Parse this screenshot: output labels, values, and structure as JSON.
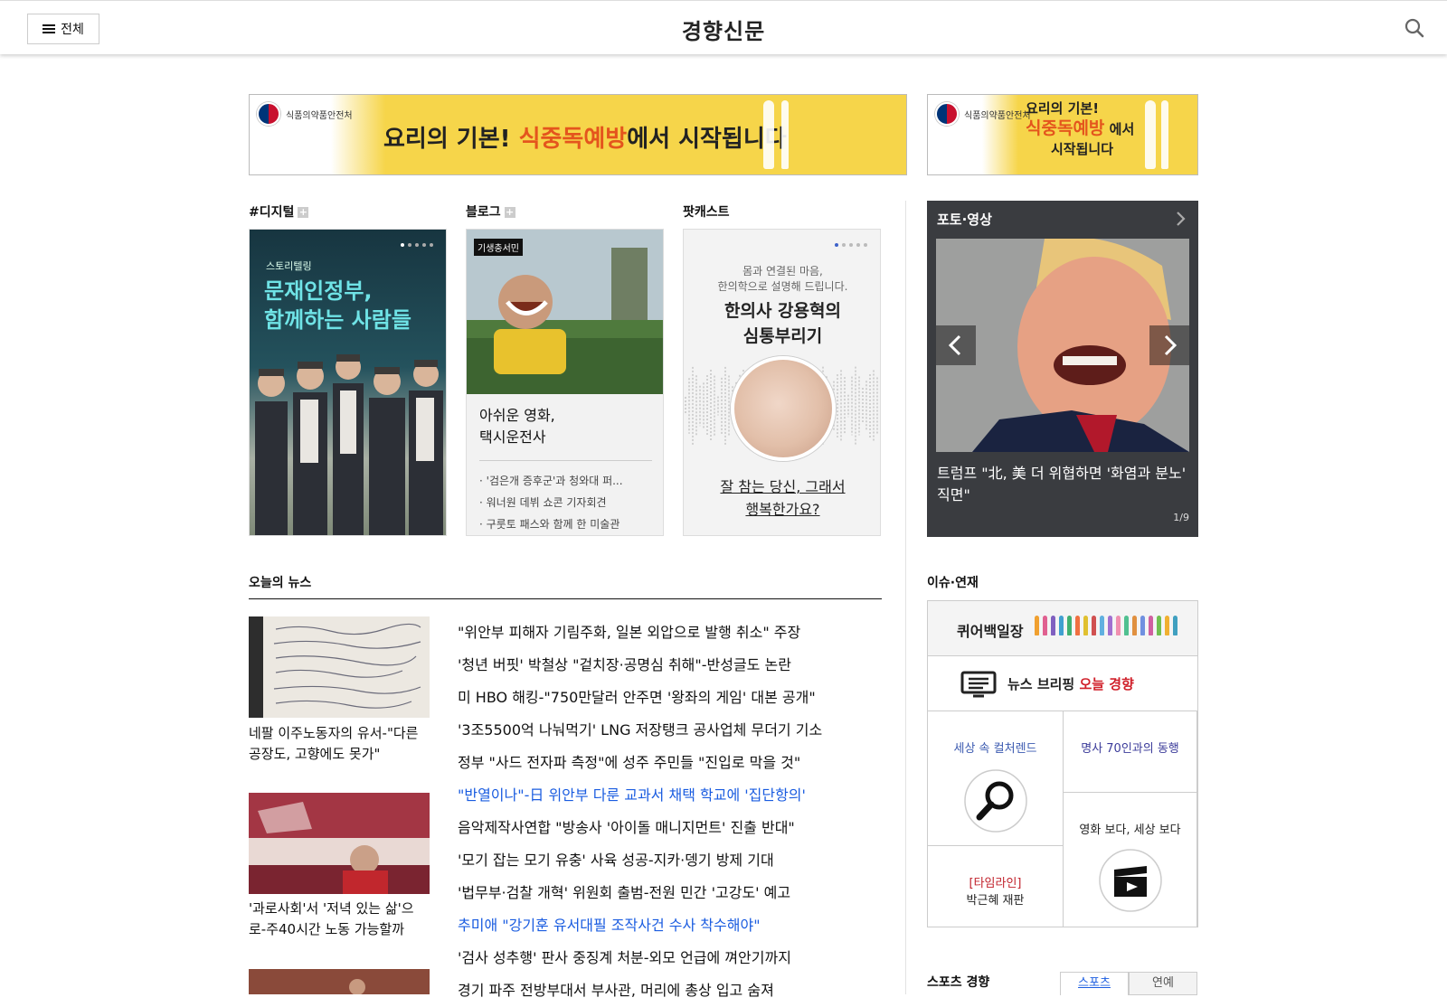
{
  "header": {
    "menu_label": "전체",
    "logo": "경향신문"
  },
  "ads": {
    "agency": "식품의약품안전처",
    "left_copy_1": "요리의 기본!",
    "left_copy_hi": "식중독예방",
    "left_copy_2": "에서 시작됩니다",
    "right_copy_1": "요리의 기본!",
    "right_copy_hi": "식중독예방",
    "right_copy_2": "에서",
    "right_copy_3": "시작됩니다"
  },
  "sections": {
    "digital": {
      "title": "#디지털",
      "kicker": "스토리텔링",
      "headline_1": "문재인정부,",
      "headline_2": "함께하는 사람들"
    },
    "blog": {
      "title": "블로그",
      "tag": "기생충서민",
      "title_1": "아쉬운 영화,",
      "title_2": "택시운전사",
      "items": [
        "'검은개 증후군'과 청와대 퍼...",
        "워너원 데뷔 쇼콘 기자회견",
        "구룻토 패스와 함께 한 미술관"
      ]
    },
    "podcast": {
      "title": "팟캐스트",
      "sub_1": "몸과 연결된 마음,",
      "sub_2": "한의학으로 설명해 드립니다.",
      "title_1": "한의사 강용혁의",
      "title_2": "심통부리기",
      "bottom_1": "잘 참는 당신, 그래서",
      "bottom_2": "행복한가요?"
    },
    "photo": {
      "title": "포토·영상",
      "caption": "트럼프 \"北, 美 더 위협하면 '화염과 분노' 직면\"",
      "counter": "1/9"
    }
  },
  "news": {
    "title": "오늘의 뉴스",
    "thumbs": [
      {
        "caption": "네팔 이주노동자의 유서-\"다른 공장도, 고향에도 못가\""
      },
      {
        "caption": "'과로사회'서 '저녁 있는 삶'으로-주40시간 노동 가능할까"
      }
    ],
    "headlines": [
      "\"위안부 피해자 기림주화, 일본 외압으로 발행 취소\" 주장",
      "'청년 버핏' 박철상 \"겉치장·공명심 취해\"-반성글도 논란",
      "미 HBO 해킹-\"750만달러 안주면 '왕좌의 게임' 대본 공개\"",
      "'3조5500억 나눠먹기' LNG 저장탱크 공사업체 무더기 기소",
      "정부 \"사드 전자파 측정\"에 성주 주민들 \"진입로 막을 것\"",
      "\"반열이나\"-日 위안부 다룬 교과서 채택 학교에 '집단항의'",
      "음악제작사연합 \"방송사 '아이돌 매니지먼트' 진출 반대\"",
      "'모기 잡는 모기 유충' 사육 성공-지카·뎅기 방제 기대",
      "'법무부·검찰 개혁' 위원회 출범-전원 민간 '고강도' 예고",
      "추미애 \"강기훈 유서대필 조작사건 수사 착수해야\"",
      "'검사 성추행' 판사 중징계 처분-외모 언급에 껴안기까지",
      "경기 파주 전방부대서 부사관, 머리에 총상 입고 숨져"
    ]
  },
  "issue": {
    "title": "이슈·연재",
    "queer": "퀴어백일장",
    "briefing": "뉴스 브리핑",
    "briefing_hi": "오늘 경향",
    "culture": "세상 속 컬처렌드",
    "mentor": "명사 70인과의 동행",
    "movie": "영화 보다, 세상 보다",
    "timeline_tag": "[타임라인]",
    "timeline": "박근혜 재판"
  },
  "sports": {
    "title": "스포츠 경향",
    "tabs": [
      "스포츠",
      "연예"
    ]
  },
  "colors": {
    "accent_blue": "#1a5ce0",
    "ad_yellow": "#f6d54a",
    "dark_panel": "#3a3c40"
  }
}
